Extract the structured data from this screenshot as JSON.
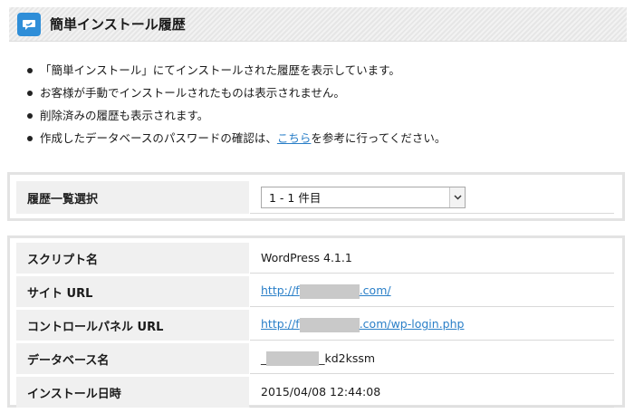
{
  "header": {
    "title": "簡単インストール履歴",
    "icon": "chat-bubble-icon",
    "icon_color": "#2f8ed8"
  },
  "notes": [
    "「簡単インストール」にてインストールされた履歴を表示しています。",
    "お客様が手動でインストールされたものは表示されません。",
    "削除済みの履歴も表示されます。"
  ],
  "note4": {
    "before": "作成したデータベースのパスワードの確認は、",
    "link": "こちら",
    "after": "を参考に行ってください。"
  },
  "history_select": {
    "label": "履歴一覧選択",
    "selected": "1 - 1 件目"
  },
  "info": {
    "script_label": "スクリプト名",
    "script_value": "WordPress 4.1.1",
    "site_url_label": "サイト URL",
    "site_url_prefix": "http://f",
    "site_url_suffix": ".com/",
    "cp_url_label": "コントロールパネル URL",
    "cp_url_prefix": "http://f",
    "cp_url_suffix": ".com/wp-login.php",
    "db_label": "データベース名",
    "db_prefix": "_",
    "db_suffix": "_kd2kssm",
    "date_label": "インストール日時",
    "date_value": "2015/04/08 12:44:08"
  },
  "colors": {
    "link": "#2a7fc8",
    "label_bg": "#f0f0f0"
  }
}
